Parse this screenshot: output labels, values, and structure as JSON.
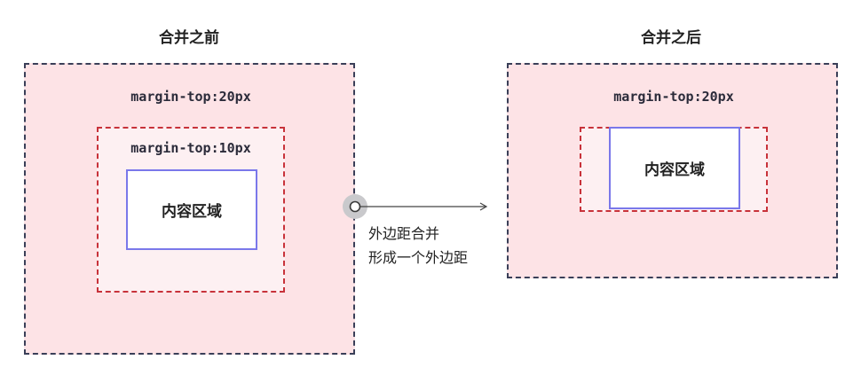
{
  "before": {
    "title": "合并之前",
    "outer_label": "margin-top:20px",
    "inner_label": "margin-top:10px",
    "content_label": "内容区域"
  },
  "after": {
    "title": "合并之后",
    "outer_label": "margin-top:20px",
    "content_label": "内容区域"
  },
  "connector": {
    "line1": "外边距合并",
    "line2": "形成一个外边距"
  },
  "colors": {
    "outer_border": "#3a3f58",
    "outer_fill": "#fde3e6",
    "inner_border": "#c8323a",
    "content_border": "#7a78ea"
  }
}
